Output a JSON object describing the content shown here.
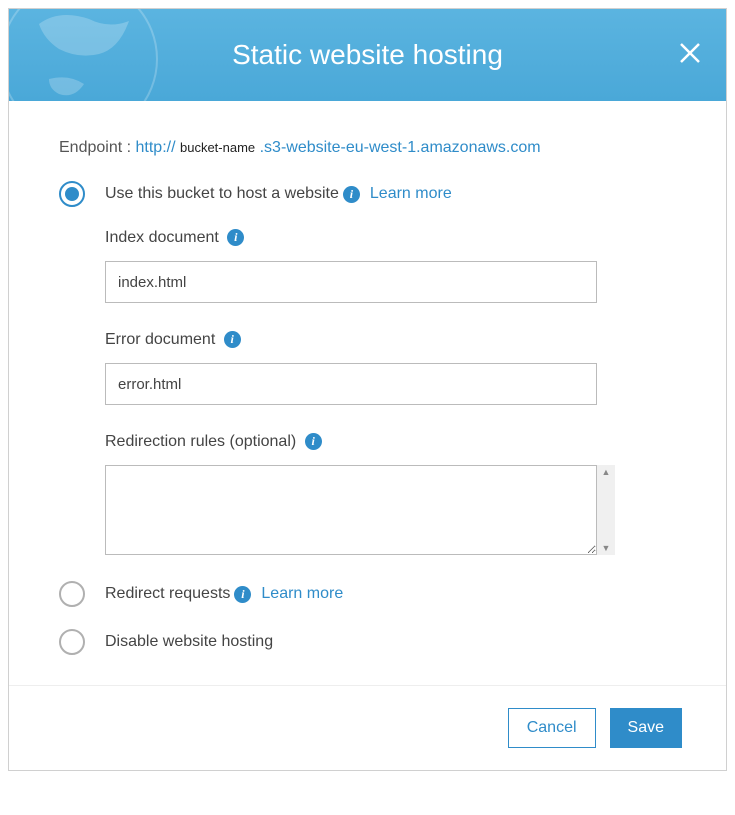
{
  "header": {
    "title": "Static website hosting"
  },
  "endpoint": {
    "label": "Endpoint : ",
    "url_prefix": "http://",
    "bucket_name": "bucket-name",
    "url_suffix": ".s3-website-eu-west-1.amazonaws.com"
  },
  "options": {
    "host": {
      "label": "Use this bucket to host a website",
      "learn_more": "Learn more",
      "selected": true
    },
    "redirect": {
      "label": "Redirect requests",
      "learn_more": "Learn more"
    },
    "disable": {
      "label": "Disable website hosting"
    }
  },
  "fields": {
    "index_document": {
      "label": "Index document",
      "value": "index.html"
    },
    "error_document": {
      "label": "Error document",
      "value": "error.html"
    },
    "redirection_rules": {
      "label": "Redirection rules (optional)",
      "value": ""
    }
  },
  "footer": {
    "cancel": "Cancel",
    "save": "Save"
  },
  "info_glyph": "i"
}
